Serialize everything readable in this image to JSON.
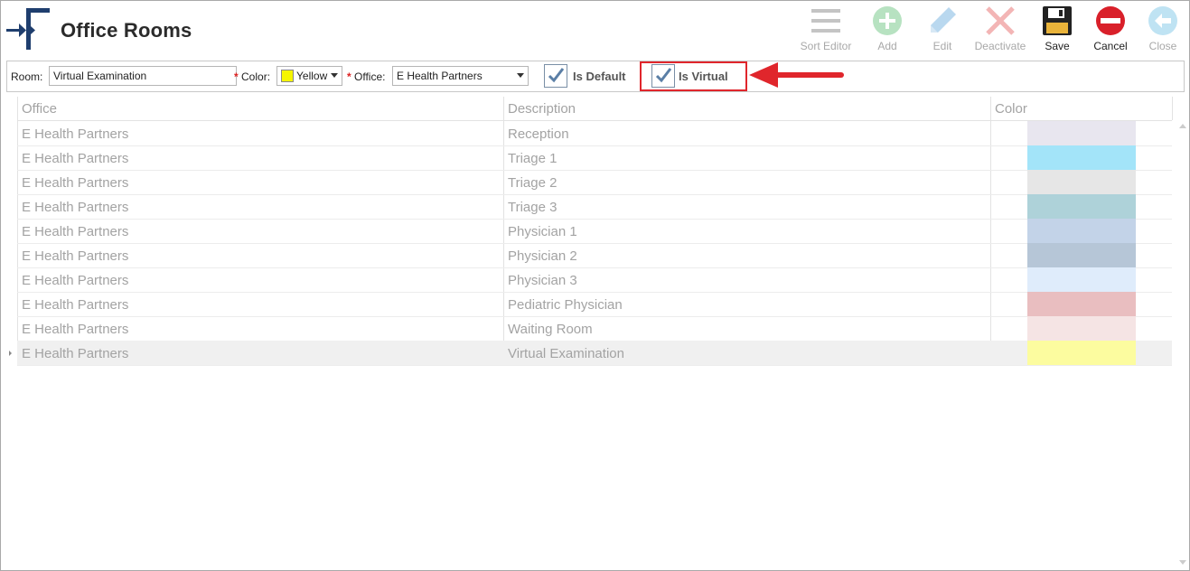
{
  "app": {
    "title": "Office Rooms"
  },
  "toolbar": {
    "sort_editor": "Sort Editor",
    "add": "Add",
    "edit": "Edit",
    "deactivate": "Deactivate",
    "save": "Save",
    "cancel": "Cancel",
    "close": "Close"
  },
  "filter": {
    "room_label": "Room:",
    "room_value": "Virtual Examination",
    "required_mark": "*",
    "color_label": "Color:",
    "color_value": "Yellow",
    "color_hex": "#f5f500",
    "office_label": "Office:",
    "office_value": "E Health Partners",
    "is_default_label": "Is Default",
    "is_default_checked": true,
    "is_virtual_label": "Is Virtual",
    "is_virtual_checked": true
  },
  "grid": {
    "columns": [
      "Office",
      "Description",
      "Color"
    ],
    "rows": [
      {
        "office": "E Health Partners",
        "description": "Reception",
        "color": "#e8e6ef"
      },
      {
        "office": "E Health Partners",
        "description": "Triage 1",
        "color": "#a3e4f9"
      },
      {
        "office": "E Health Partners",
        "description": "Triage 2",
        "color": "#e6e6e6"
      },
      {
        "office": "E Health Partners",
        "description": "Triage 3",
        "color": "#aed2d9"
      },
      {
        "office": "E Health Partners",
        "description": "Physician 1",
        "color": "#c3d3e8"
      },
      {
        "office": "E Health Partners",
        "description": "Physician 2",
        "color": "#b6c6d7"
      },
      {
        "office": "E Health Partners",
        "description": "Physician 3",
        "color": "#dfecfb"
      },
      {
        "office": "E Health Partners",
        "description": "Pediatric Physician",
        "color": "#e9bec0"
      },
      {
        "office": "E Health Partners",
        "description": "Waiting Room",
        "color": "#f5e4e4"
      },
      {
        "office": "E Health Partners",
        "description": "Virtual Examination",
        "color": "#fcfc9f"
      }
    ],
    "selected_index": 9
  },
  "colors": {
    "accent_red": "#e0262c",
    "logo_blue": "#1f3e6e",
    "checkbox_check": "#5b7fa6"
  }
}
